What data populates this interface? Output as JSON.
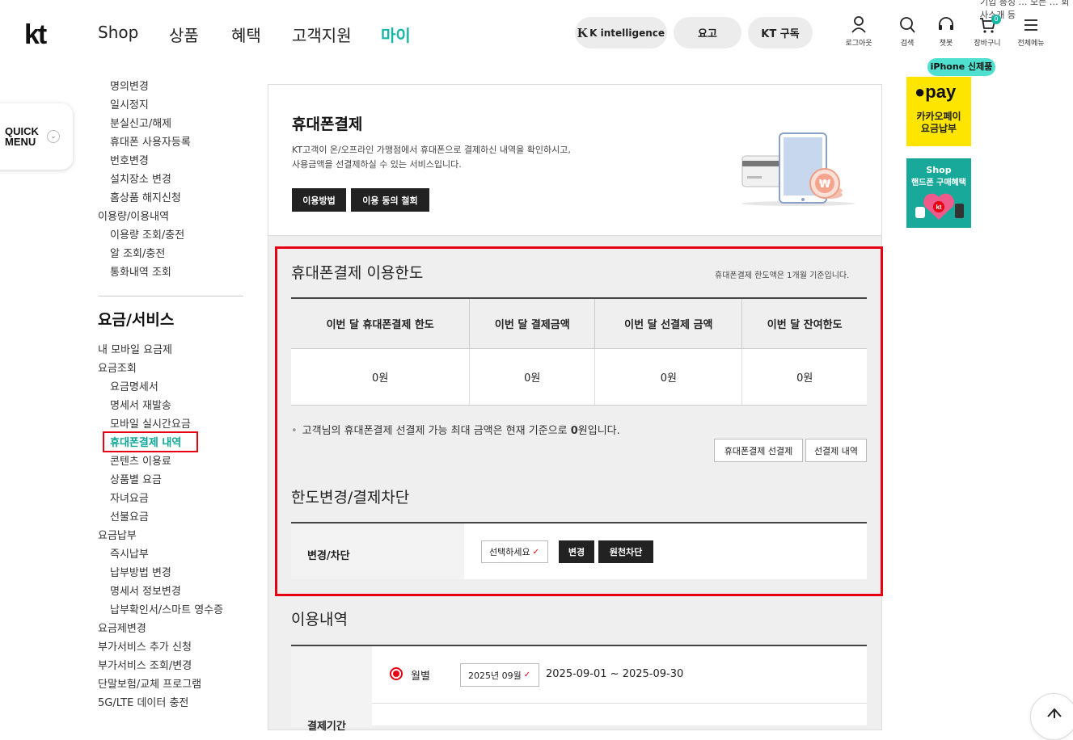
{
  "header": {
    "logo": "kt",
    "topline": "기업  총성  …  모든  …  회사소개 등",
    "nav": [
      "Shop",
      "상품",
      "혜택",
      "고객지원",
      "마이"
    ],
    "pills": [
      "K intelligence",
      "요고",
      "KT 구독"
    ],
    "utils": [
      "로그아웃",
      "검색",
      "챗봇",
      "장바구니",
      "전체메뉴"
    ],
    "cart_count": "0"
  },
  "quick_menu": {
    "line1": "QUICK",
    "line2": "MENU"
  },
  "sidebar": {
    "items_top": [
      {
        "label": "명의변경",
        "kind": "sub"
      },
      {
        "label": "일시정지",
        "kind": "sub"
      },
      {
        "label": "분실신고/해제",
        "kind": "sub"
      },
      {
        "label": "휴대폰 사용자등록",
        "kind": "sub"
      },
      {
        "label": "번호변경",
        "kind": "sub"
      },
      {
        "label": "설치장소 변경",
        "kind": "sub"
      },
      {
        "label": "홈상품 해지신청",
        "kind": "sub"
      },
      {
        "label": "이용량/이용내역",
        "kind": "top"
      },
      {
        "label": "이용량 조회/충전",
        "kind": "sub"
      },
      {
        "label": "알 조회/충전",
        "kind": "sub"
      },
      {
        "label": "통화내역 조회",
        "kind": "sub"
      }
    ],
    "section_title": "요금/서비스",
    "items": [
      {
        "label": "내 모바일 요금제",
        "kind": "top"
      },
      {
        "label": "요금조회",
        "kind": "top"
      },
      {
        "label": "요금명세서",
        "kind": "sub"
      },
      {
        "label": "명세서 재발송",
        "kind": "sub"
      },
      {
        "label": "모바일 실시간요금",
        "kind": "sub"
      },
      {
        "label": "휴대폰결제 내역",
        "kind": "active"
      },
      {
        "label": "콘텐츠 이용료",
        "kind": "sub"
      },
      {
        "label": "상품별 요금",
        "kind": "sub"
      },
      {
        "label": "자녀요금",
        "kind": "sub"
      },
      {
        "label": "선불요금",
        "kind": "sub"
      },
      {
        "label": "요금납부",
        "kind": "top"
      },
      {
        "label": "즉시납부",
        "kind": "sub"
      },
      {
        "label": "납부방법 변경",
        "kind": "sub"
      },
      {
        "label": "명세서 정보변경",
        "kind": "sub"
      },
      {
        "label": "납부확인서/스마트 영수증",
        "kind": "sub"
      },
      {
        "label": "요금제변경",
        "kind": "top"
      },
      {
        "label": "부가서비스 추가 신청",
        "kind": "top"
      },
      {
        "label": "부가서비스 조회/변경",
        "kind": "top"
      },
      {
        "label": "단말보험/교체 프로그램",
        "kind": "top"
      },
      {
        "label": "5G/LTE 데이터 충전",
        "kind": "top"
      }
    ]
  },
  "intro": {
    "title": "휴대폰결제",
    "desc1": "KT고객이 온/오프라인 가맹점에서 휴대폰으로 결제하신 내역을 확인하시고,",
    "desc2": "사용금액을 선결제하실 수 있는 서비스입니다.",
    "btn_usage": "이용방법",
    "btn_withdraw": "이용 동의 철회"
  },
  "limit": {
    "title": "휴대폰결제 이용한도",
    "note": "휴대폰결제 한도액은 1개월 기준입니다.",
    "headers": [
      "이번 달 휴대폰결제 한도",
      "이번 달 결제금액",
      "이번 달 선결제 금액",
      "이번 달 잔여한도"
    ],
    "values": [
      "0원",
      "0원",
      "0원",
      "0원"
    ],
    "bullet_pre": "고객님의 휴대폰결제 선결제 가능 최대 금액은 현재 기준으로 ",
    "bullet_bold": "0",
    "bullet_post": "원입니다.",
    "btn_prepay": "휴대폰결제 선결제",
    "btn_prepay_history": "선결제 내역"
  },
  "change": {
    "title": "한도변경/결제차단",
    "row_label": "변경/차단",
    "select_value": "선택하세요",
    "btn_change": "변경",
    "btn_block": "원천차단"
  },
  "history": {
    "title": "이용내역",
    "row_label": "결제기간",
    "radio_label": "월별",
    "month_value": "2025년 09월",
    "range": "2025-09-01 ~ 2025-09-30"
  },
  "banners": {
    "iphone_tag": "iPhone 신제품",
    "kpay_logo": "pay",
    "kpay_text1": "카카오페이",
    "kpay_text2": "요금납부",
    "shop_text1": "Shop",
    "shop_text2": "핸드폰 구매혜택"
  },
  "colors": {
    "accent": "#18b6a6",
    "highlight_red": "#e60012",
    "kpay_yellow": "#fee500"
  }
}
